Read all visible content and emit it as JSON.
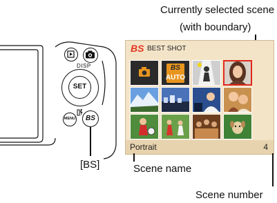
{
  "callouts": {
    "selected_scene_line1": "Currently selected scene",
    "selected_scene_line2": "(with boundary)",
    "scene_name": "Scene name",
    "scene_number": "Scene number",
    "bs_button": "[BS]"
  },
  "screen": {
    "logo": "BS",
    "title": "BEST SHOT",
    "auto_badge_top": "BS",
    "auto_badge_bottom": "AUTO",
    "footer_name": "Portrait",
    "footer_number": "4",
    "selected_color": "#e0271b"
  },
  "camera": {
    "disp_label": "DISP",
    "set_label": "SET",
    "menu_label": "MENU",
    "bs_button_label": "BS",
    "buttons": [
      "play-icon",
      "camera-icon",
      "set-button",
      "menu-button",
      "delete-flash-icon",
      "bs-button"
    ]
  }
}
